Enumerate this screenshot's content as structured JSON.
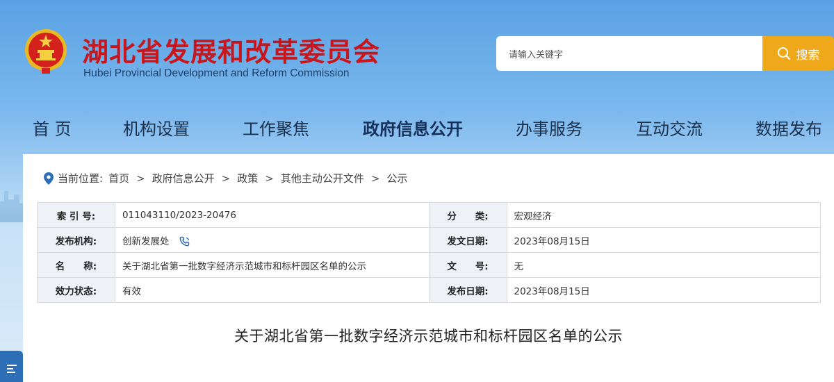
{
  "header": {
    "title": "湖北省发展和改革委员会",
    "subtitle": "Hubei Provincial Development and Reform Commission",
    "emblem_icon": "national-emblem-icon",
    "title_color": "#c8161d"
  },
  "search": {
    "placeholder": "请输入关键字",
    "button_label": "搜索",
    "button_color": "#f0a81b"
  },
  "nav": {
    "items": [
      {
        "label": "首 页"
      },
      {
        "label": "机构设置"
      },
      {
        "label": "工作聚焦"
      },
      {
        "label": "政府信息公开",
        "active": true
      },
      {
        "label": "办事服务"
      },
      {
        "label": "互动交流"
      },
      {
        "label": "数据发布"
      }
    ]
  },
  "breadcrumb": {
    "prefix": "当前位置:",
    "items": [
      "首页",
      "政府信息公开",
      "政策",
      "其他主动公开文件",
      "公示"
    ],
    "separator": ">"
  },
  "meta": {
    "rows": [
      {
        "l1": "索 引 号:",
        "v1": "011043110/2023-20476",
        "l2": "分　　类:",
        "v2": "宏观经济"
      },
      {
        "l1": "发布机构:",
        "v1": "创新发展处",
        "l2": "发文日期:",
        "v2": "2023年08月15日"
      },
      {
        "l1": "名　　称:",
        "v1": "关于湖北省第一批数字经济示范城市和标杆园区名单的公示",
        "l2": "文　　号:",
        "v2": "无"
      },
      {
        "l1": "效力状态:",
        "v1": "有效",
        "l2": "发布日期:",
        "v2": "2023年08月15日"
      }
    ]
  },
  "document": {
    "title": "关于湖北省第一批数字经济示范城市和标杆园区名单的公示"
  },
  "colors": {
    "accent_blue": "#2c6fb7",
    "header_bg": "#5aa2e4"
  }
}
